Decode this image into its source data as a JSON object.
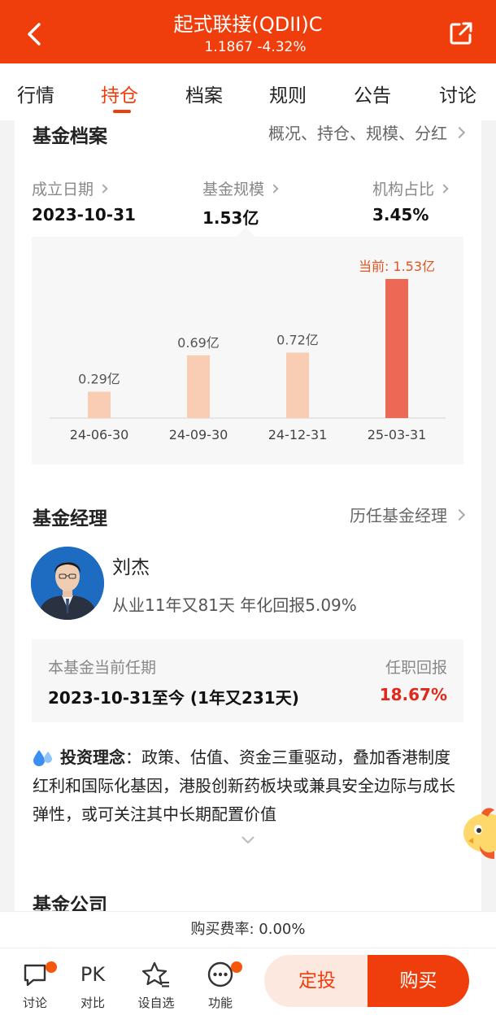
{
  "header": {
    "title": "起式联接(QDII)C",
    "nav_value": "1.1867",
    "change_pct": "-4.32%",
    "bg_color": "#ef3d0b"
  },
  "tabs": [
    {
      "label": "行情"
    },
    {
      "label": "持仓",
      "active": true
    },
    {
      "label": "档案"
    },
    {
      "label": "规则"
    },
    {
      "label": "公告"
    },
    {
      "label": "讨论"
    }
  ],
  "profile": {
    "title": "基金档案",
    "link": "概况、持仓、规模、分红",
    "stats": [
      {
        "label": "成立日期",
        "value": "2023-10-31"
      },
      {
        "label": "基金规模",
        "value": "1.53亿"
      },
      {
        "label": "机构占比",
        "value": "3.45%"
      }
    ]
  },
  "chart_data": {
    "type": "bar",
    "categories": [
      "24-06-30",
      "24-09-30",
      "24-12-31",
      "25-03-31"
    ],
    "values": [
      0.29,
      0.69,
      0.72,
      1.53
    ],
    "data_labels": [
      "0.29亿",
      "0.69亿",
      "0.72亿",
      "当前: 1.53亿"
    ],
    "unit": "亿",
    "ylim": [
      0,
      1.53
    ],
    "colors": {
      "past": "#f8cdb4",
      "current": "#ec6a55",
      "current_label": "#e2541f"
    }
  },
  "manager": {
    "title": "基金经理",
    "link": "历任基金经理",
    "name": "刘杰",
    "experience": "从业11年又81天 年化回报5.09%",
    "tenure_label": "本基金当前任期",
    "tenure_value": "2023-10-31至今 (1年又231天)",
    "return_label": "任职回报",
    "return_value": "18.67%",
    "philosophy_label": "投资理念",
    "philosophy_text": "：政策、估值、资金三重驱动，叠加香港制度红利和国际化基因，港股创新药板块或兼具安全边际与成长弹性，或可关注其中长期配置价值"
  },
  "company": {
    "title": "基金公司"
  },
  "fee": {
    "text": "购买费率: 0.00%"
  },
  "bottom_bar": {
    "items": [
      {
        "label": "讨论",
        "icon": "chat-icon"
      },
      {
        "label": "对比",
        "icon_text": "PK"
      },
      {
        "label": "设自选",
        "icon": "star-add-icon"
      },
      {
        "label": "功能",
        "icon": "more-icon"
      }
    ],
    "dingtou_label": "定投",
    "buy_label": "购买"
  }
}
